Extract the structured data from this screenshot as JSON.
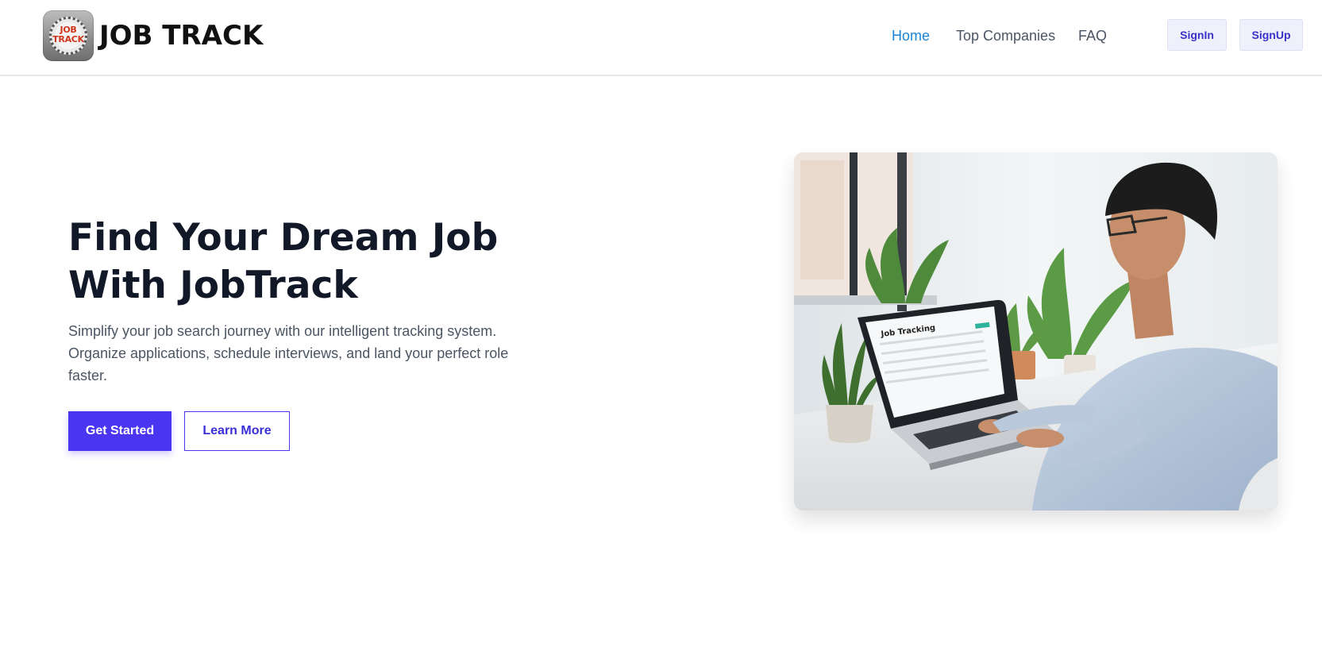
{
  "header": {
    "brand": "JOB TRACK",
    "logo_text_line1": "JOB",
    "logo_text_line2": "TRACK",
    "nav": [
      {
        "label": "Home",
        "active": true
      },
      {
        "label": "Top Companies",
        "active": false
      },
      {
        "label": "FAQ",
        "active": false
      }
    ],
    "signin_label": "SignIn",
    "signup_label": "SignUp"
  },
  "hero": {
    "title_line1": "Find Your Dream Job",
    "title_line2": "With JobTrack",
    "description": "Simplify your job search journey with our intelligent tracking system. Organize applications, schedule interviews, and land your perfect role faster.",
    "primary_button": "Get Started",
    "secondary_button": "Learn More",
    "image": {
      "subject": "person-typing-on-laptop-icon",
      "laptop_screen_heading": "Job Tracking"
    }
  },
  "colors": {
    "accent": "#4a36f0",
    "nav_active": "#1d84d6",
    "heading": "#111827",
    "body_text": "#4b5563"
  }
}
